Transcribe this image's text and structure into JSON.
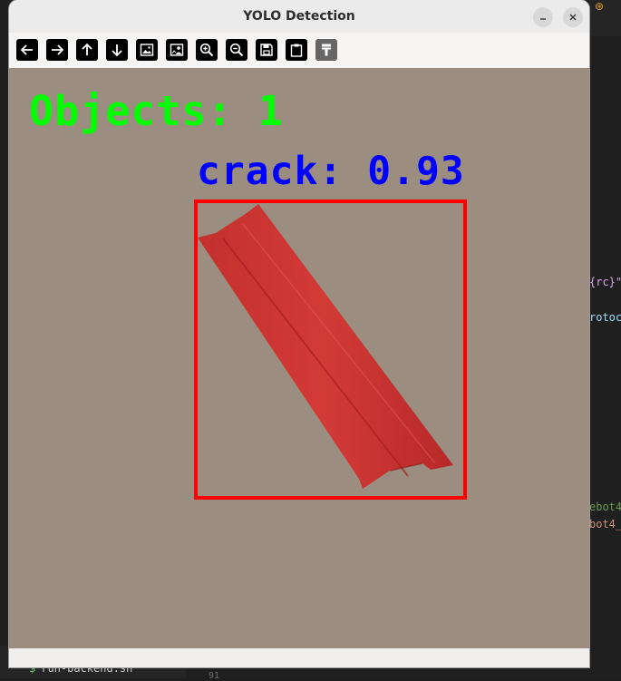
{
  "window": {
    "title": "YOLO Detection"
  },
  "toolbar": {
    "buttons": [
      {
        "name": "back-button",
        "icon": "arrow-left-icon"
      },
      {
        "name": "forward-button",
        "icon": "arrow-right-icon"
      },
      {
        "name": "up-button",
        "icon": "arrow-up-icon"
      },
      {
        "name": "down-button",
        "icon": "arrow-down-icon"
      },
      {
        "name": "image-button",
        "icon": "image-icon"
      },
      {
        "name": "image-person-button",
        "icon": "image-person-icon"
      },
      {
        "name": "zoom-in-button",
        "icon": "zoom-in-icon"
      },
      {
        "name": "zoom-out-button",
        "icon": "zoom-out-icon"
      },
      {
        "name": "save-button",
        "icon": "save-icon"
      },
      {
        "name": "clipboard-button",
        "icon": "clipboard-icon"
      },
      {
        "name": "properties-button",
        "icon": "paint-brush-icon"
      }
    ]
  },
  "overlay": {
    "objects_label": "Objects: 1",
    "detection_label": "crack: 0.93",
    "colors": {
      "count_text": "#00ff00",
      "label_text": "#0000ff",
      "box": "#ff0000"
    }
  },
  "background_editor": {
    "lines": [
      {
        "text": "{rc}\"",
        "color": "#d7a6e6"
      },
      {
        "text": "rotoc",
        "color": "#9cdcfe"
      },
      {
        "text": "ebot4",
        "color": "#6a9955"
      },
      {
        "text": "bot4_",
        "color": "#ce9178"
      }
    ],
    "terminal_file": "run-backend.sh",
    "terminal_prompt": "$",
    "line_number": "91"
  }
}
